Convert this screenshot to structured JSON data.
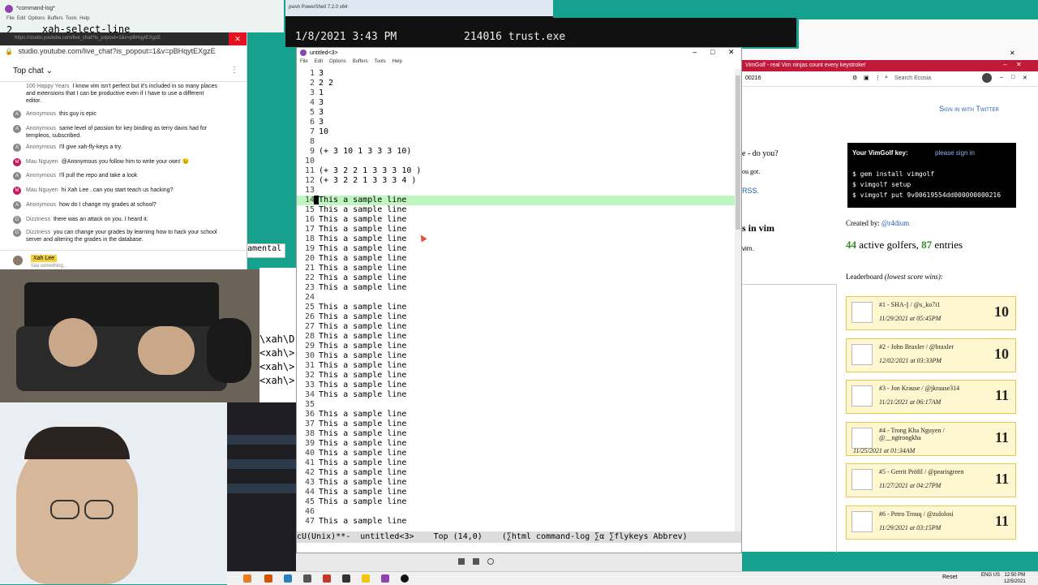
{
  "topbar": {
    "cmdlog_title": "*command-log*",
    "cmdlog_menu": "File  Edit  Options  Buffers  Tools  Help",
    "cmdlog_line_num": "2",
    "cmdlog_command": "xah-select-line",
    "ps_title": "pwsh PowerShell 7.2.0 x64",
    "ps_datetime": "1/8/2021  3:43 PM",
    "ps_file": "214016 trust.exe"
  },
  "chat": {
    "url": "https://studio.youtube.com/live_chat?is_popout=1&v=pBHqytEXgzE",
    "url_short": "studio.youtube.com/live_chat?is_popout=1&v=pBHqytEXgzE",
    "header": "Top chat",
    "messages": [
      {
        "avatar": "",
        "author": "100 Happy Years",
        "text": "I know vim isn't perfect but it's included in so many places and extensions that I can be productive even if I have to use a different editor."
      },
      {
        "avatar": "A",
        "author": "Anonymous",
        "text": "this guy is epic"
      },
      {
        "avatar": "A",
        "author": "Anonymous",
        "text": "same level of passion for key binding as terry davis had for templeos, subscribed."
      },
      {
        "avatar": "A",
        "author": "Anonymous",
        "text": "I'll give xah-fly-keys a try."
      },
      {
        "avatar": "M",
        "author": "Mau Nguyen",
        "text": "@Anonymous you follow him to write your own! 😉"
      },
      {
        "avatar": "A",
        "author": "Anonymous",
        "text": "I'll pull the repo and take a look"
      },
      {
        "avatar": "M",
        "author": "Mau Nguyen",
        "text": "hi Xah Lee ..can you start teach us hacking?"
      },
      {
        "avatar": "A",
        "author": "Anonymous",
        "text": "how do I change my grades at school?"
      },
      {
        "avatar": "D",
        "author": "Dizziness",
        "text": "there was an attack on you. I heard it."
      },
      {
        "avatar": "D",
        "author": "Dizziness",
        "text": "you can change your grades by learning how to hack your school server and altering the grades in the database."
      }
    ],
    "input_user": "Xah Lee",
    "input_placeholder": "Say something..."
  },
  "terminal_side": {
    "lines": [
      "\\xah\\D",
      "<xah\\>",
      "<xah\\>",
      "<xah\\>"
    ],
    "fragment": "amental"
  },
  "emacs": {
    "title": "untitled<3>",
    "menu": [
      "File",
      "Edit",
      "Options",
      "Buffers",
      "Tools",
      "Help"
    ],
    "lines": [
      {
        "n": "1",
        "t": "3"
      },
      {
        "n": "2",
        "t": "2 2"
      },
      {
        "n": "3",
        "t": "1"
      },
      {
        "n": "4",
        "t": "3"
      },
      {
        "n": "5",
        "t": "3"
      },
      {
        "n": "6",
        "t": "3"
      },
      {
        "n": "7",
        "t": "10"
      },
      {
        "n": "8",
        "t": ""
      },
      {
        "n": "9",
        "t": "(+ 3 10 1 3 3 3 10)"
      },
      {
        "n": "10",
        "t": ""
      },
      {
        "n": "11",
        "t": "(+ 3 2 2 1 3 3 3 10 )"
      },
      {
        "n": "12",
        "t": "(+ 3 2 2 1 3 3 3 4 )"
      },
      {
        "n": "13",
        "t": ""
      },
      {
        "n": "14",
        "t": "This a sample line",
        "hl": true
      },
      {
        "n": "15",
        "t": "This a sample line"
      },
      {
        "n": "16",
        "t": "This a sample line"
      },
      {
        "n": "17",
        "t": "This a sample line"
      },
      {
        "n": "18",
        "t": "This a sample line"
      },
      {
        "n": "19",
        "t": "This a sample line"
      },
      {
        "n": "20",
        "t": "This a sample line"
      },
      {
        "n": "21",
        "t": "This a sample line"
      },
      {
        "n": "22",
        "t": "This a sample line"
      },
      {
        "n": "23",
        "t": "This a sample line"
      },
      {
        "n": "24",
        "t": ""
      },
      {
        "n": "25",
        "t": "This a sample line"
      },
      {
        "n": "26",
        "t": "This a sample line"
      },
      {
        "n": "27",
        "t": "This a sample line"
      },
      {
        "n": "28",
        "t": "This a sample line"
      },
      {
        "n": "29",
        "t": "This a sample line"
      },
      {
        "n": "30",
        "t": "This a sample line"
      },
      {
        "n": "31",
        "t": "This a sample line"
      },
      {
        "n": "32",
        "t": "This a sample line"
      },
      {
        "n": "33",
        "t": "This a sample line"
      },
      {
        "n": "34",
        "t": "This a sample line"
      },
      {
        "n": "35",
        "t": ""
      },
      {
        "n": "36",
        "t": "This a sample line"
      },
      {
        "n": "37",
        "t": "This a sample line"
      },
      {
        "n": "38",
        "t": "This a sample line"
      },
      {
        "n": "39",
        "t": "This a sample line"
      },
      {
        "n": "40",
        "t": "This a sample line"
      },
      {
        "n": "41",
        "t": "This a sample line"
      },
      {
        "n": "42",
        "t": "This a sample line"
      },
      {
        "n": "43",
        "t": "This a sample line"
      },
      {
        "n": "44",
        "t": "This a sample line"
      },
      {
        "n": "45",
        "t": "This a sample line"
      },
      {
        "n": "46",
        "t": ""
      },
      {
        "n": "47",
        "t": "This a sample line"
      }
    ],
    "modeline": "cU(Unix)**-  untitled<3>    Top (14,0)    (∑html command-log ∑α ∑flykeys Abbrev)"
  },
  "browser": {
    "tab_title": "VimGolf - real Vim ninjas count every keystroke!",
    "search_placeholder": "Search Ecosia",
    "left_address": "00216",
    "sign_in": "Sign in with Twitter",
    "partial_texts": [
      "e - do you?",
      "ou got.",
      "RSS.",
      "s in vim",
      "vim."
    ],
    "key_title": "Your VimGolf key:",
    "key_value": "please sign in",
    "key_commands": [
      "$ gem install vimgolf",
      "$ vimgolf setup",
      "$ vimgolf put 9v00619554dd000000000216"
    ],
    "created_by_label": "Created by:",
    "created_by": "@r4dium",
    "golfers_count": "44",
    "golfers_label": "active golfers,",
    "entries_count": "87",
    "entries_label": "entries",
    "leaderboard_title": "Leaderboard",
    "leaderboard_note": "(lowest score wins):",
    "entries": [
      {
        "rank": "#1 - SHA-|| / @s_ko7i1",
        "date": "11/29/2021 at 05:45PM",
        "score": "10"
      },
      {
        "rank": "#2 - John Braxler / @braxler",
        "date": "12/02/2021 at 03:33PM",
        "score": "10"
      },
      {
        "rank": "#3 - Jon Krause / @jkrause314",
        "date": "11/21/2021 at 06:17AM",
        "score": "11"
      },
      {
        "rank": "#4 - Trong Kha Nguyen / @__ngtrongkha",
        "date": "11/25/2021 at 01:34AM",
        "score": "11"
      },
      {
        "rank": "#5 - Gerrit Pröfil / @pearisgreen",
        "date": "11/27/2021 at 04:27PM",
        "score": "11"
      },
      {
        "rank": "#6 - Petro Trouq / @zulolosi",
        "date": "11/29/2021 at 03:15PM",
        "score": "11"
      }
    ]
  },
  "taskbar": {
    "time": "12:50 PM",
    "date": "12/5/2021",
    "reset": "Reset",
    "lang": "ENG US"
  },
  "colors": {
    "teal_bg": "#16a08e",
    "emacs_highlight": "#bff5bf",
    "vimgolf_tab": "#c1193a",
    "leaderboard_bg": "#fff7d0"
  }
}
